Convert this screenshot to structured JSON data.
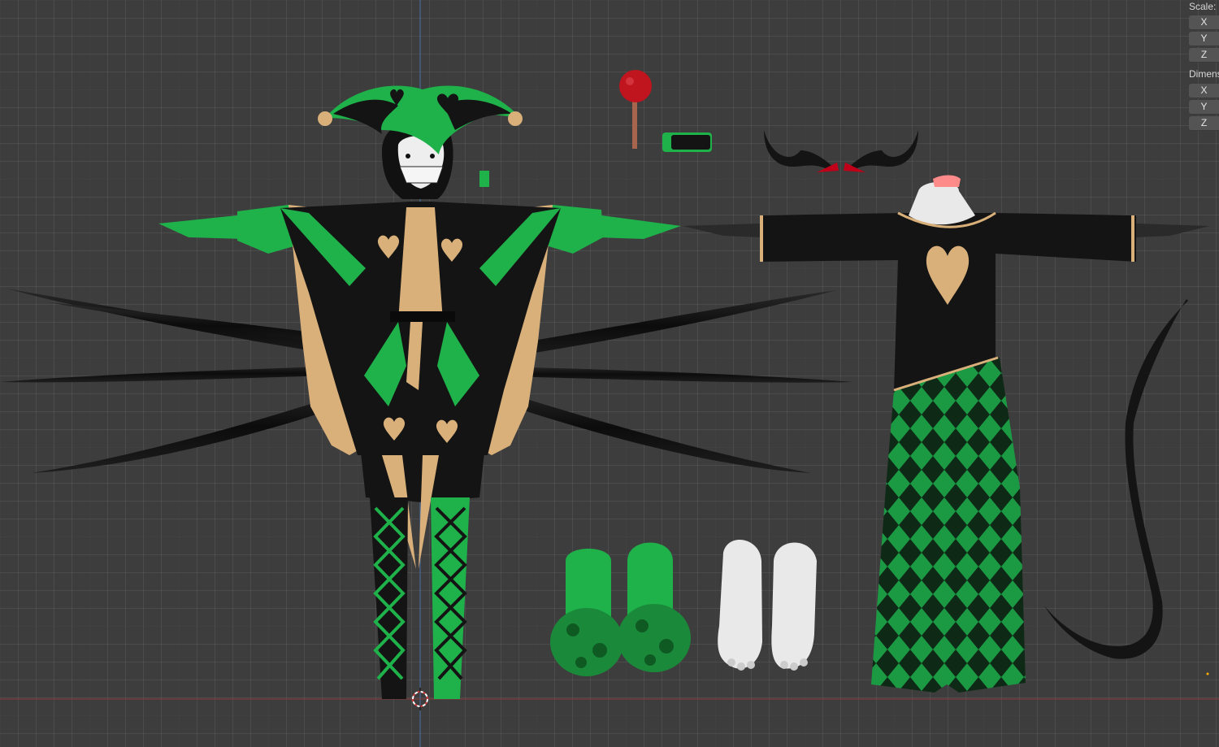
{
  "viewport": {
    "background": "#3d3d3d",
    "grid_visible": true,
    "axis_x_color": "#8a3a3a",
    "axis_z_color": "#4a6fa5",
    "cursor_icon": "3d-cursor-icon"
  },
  "sidebar": {
    "scale": {
      "label": "Scale:",
      "x": "X",
      "y": "Y",
      "z": "Z"
    },
    "dimensions": {
      "label": "Dimens",
      "x": "X",
      "y": "Y",
      "z": "Z"
    }
  },
  "scene": {
    "objects": [
      "jester",
      "apple",
      "tag",
      "horns",
      "torso",
      "tentacles",
      "slippers",
      "feet",
      "tail"
    ],
    "colors": {
      "green": "#1fb14a",
      "gold": "#d9b07a",
      "black": "#141414",
      "white": "#e9e9e9",
      "red": "#c00018"
    }
  }
}
